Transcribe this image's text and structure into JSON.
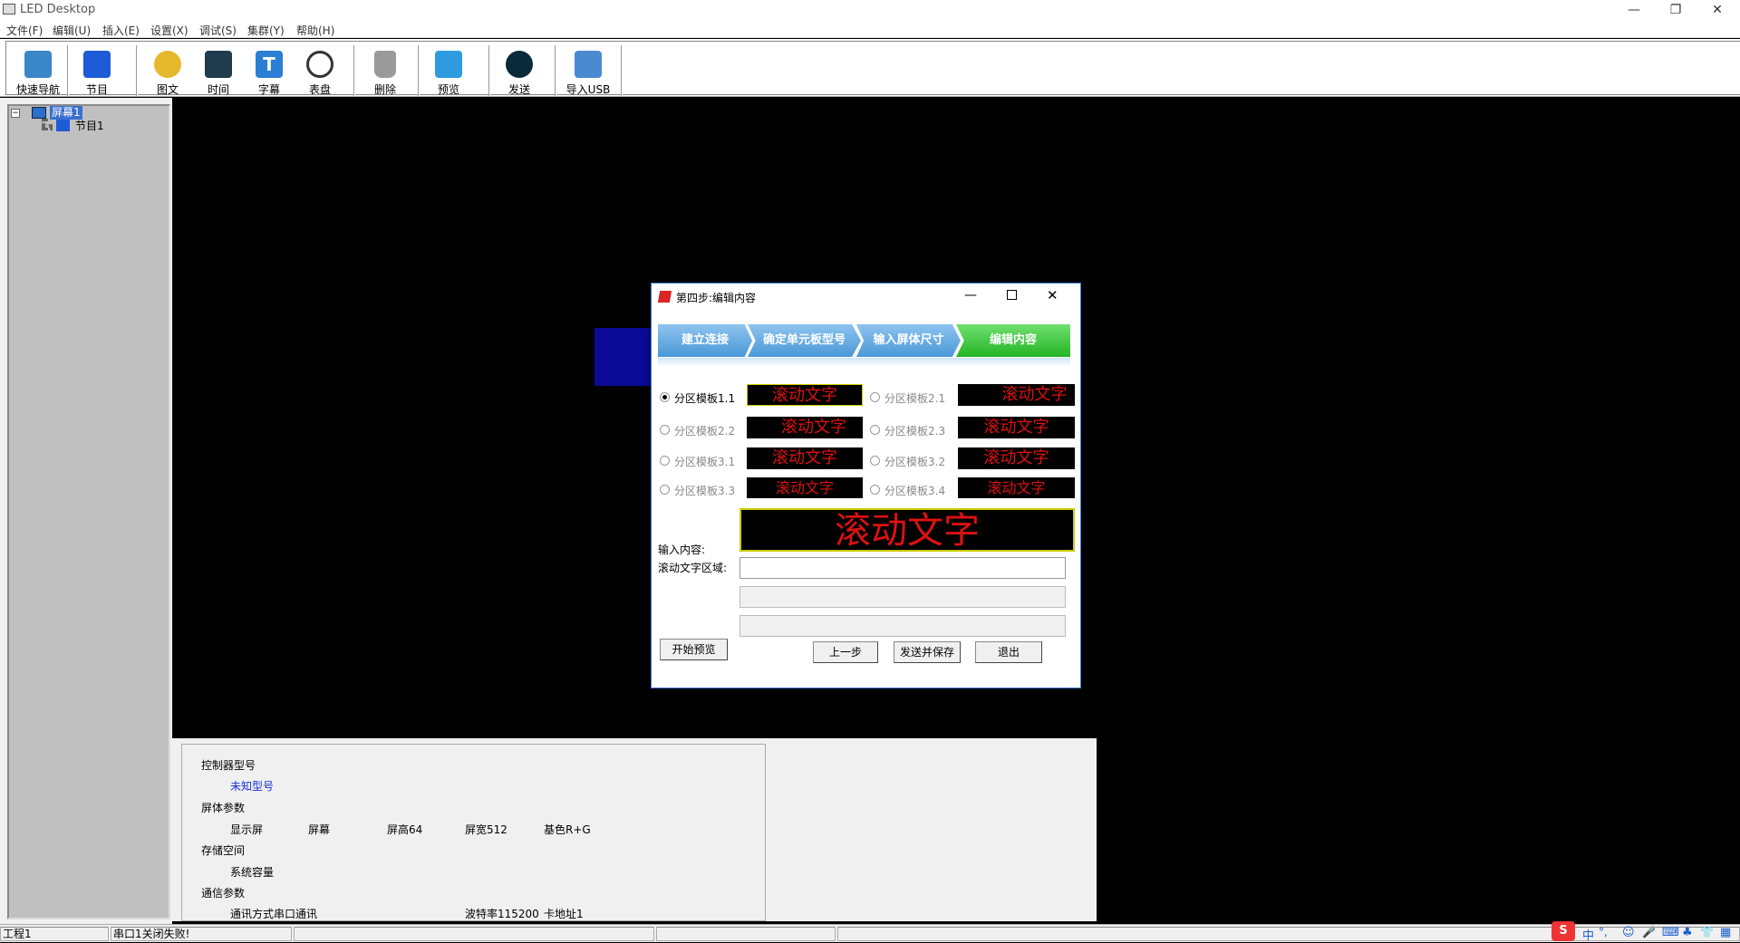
{
  "window": {
    "title": "LED Desktop",
    "minimize": "—",
    "restore": "❐",
    "close": "✕"
  },
  "menu": [
    "文件(F)",
    "编辑(U)",
    "插入(E)",
    "设置(X)",
    "调试(S)",
    "集群(Y)",
    "帮助(H)"
  ],
  "toolbar": [
    {
      "label": "快速导航",
      "icon": "monitor-icon",
      "color": "#3a86c8"
    },
    {
      "label": "节目",
      "icon": "clapper-icon",
      "color": "#1e5bd6"
    },
    {
      "label": "图文",
      "icon": "sunflower-icon",
      "color": "#e6b82d"
    },
    {
      "label": "时间",
      "icon": "digital-clock-icon",
      "color": "#1f3b4d"
    },
    {
      "label": "字幕",
      "icon": "text-t-icon",
      "color": "#2a7fd4"
    },
    {
      "label": "表盘",
      "icon": "analog-clock-icon",
      "color": "#333333"
    },
    {
      "label": "删除",
      "icon": "trash-icon",
      "color": "#9a9a9a"
    },
    {
      "label": "预览",
      "icon": "camera-icon",
      "color": "#2e9ae0"
    },
    {
      "label": "发送",
      "icon": "play-icon",
      "color": "#0a2a3a"
    },
    {
      "label": "导入USB",
      "icon": "usb-search-icon",
      "color": "#4a8ad0"
    }
  ],
  "tree": {
    "root": "屏幕1",
    "child": "节目1",
    "expander": "−"
  },
  "dialog": {
    "title": "第四步:编辑内容",
    "steps": [
      "建立连接",
      "确定单元板型号",
      "输入屏体尺寸",
      "编辑内容"
    ],
    "templates": [
      {
        "label": "分区模板1.1",
        "preview": "滚动文字",
        "selected": true
      },
      {
        "label": "分区模板2.1",
        "preview": "滚动文字",
        "selected": false
      },
      {
        "label": "分区模板2.2",
        "preview": "滚动文字",
        "selected": false
      },
      {
        "label": "分区模板2.3",
        "preview": "滚动文字",
        "selected": false
      },
      {
        "label": "分区模板3.1",
        "preview": "滚动文字",
        "selected": false
      },
      {
        "label": "分区模板3.2",
        "preview": "滚动文字",
        "selected": false
      },
      {
        "label": "分区模板3.3",
        "preview": "滚动文字",
        "selected": false
      },
      {
        "label": "分区模板3.4",
        "preview": "滚动文字",
        "selected": false
      }
    ],
    "big_preview": "滚动文字",
    "input_label": "输入内容:",
    "scroll_area_label": "滚动文字区域:",
    "input_value": "",
    "buttons": {
      "preview": "开始预览",
      "prev": "上一步",
      "send_save": "发送并保存",
      "exit": "退出"
    }
  },
  "info": {
    "controller_heading": "控制器型号",
    "controller_value": "未知型号",
    "screen_heading": "屏体参数",
    "display": "显示屏",
    "screen": "屏幕",
    "height": "屏高64",
    "width": "屏宽512",
    "color": "基色R+G",
    "storage_heading": "存储空间",
    "system_capacity": "系统容量",
    "comm_heading": "通信参数",
    "comm_mode": "通讯方式串口通讯",
    "baud": "波特率115200",
    "card_address": "卡地址1"
  },
  "status": {
    "project": "工程1",
    "message": "串口1关闭失败!"
  },
  "tray": [
    "中",
    "°,",
    "☺",
    "🎤",
    "⌨",
    "♣",
    "👕",
    "▦"
  ]
}
